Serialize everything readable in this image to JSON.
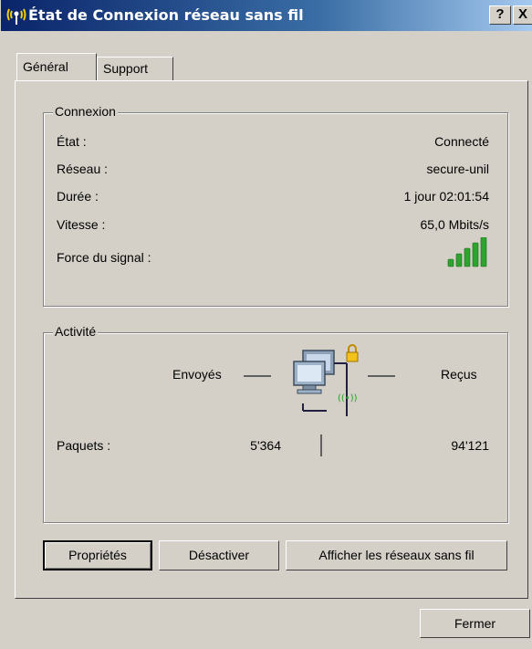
{
  "window": {
    "title": "État de Connexion réseau sans fil",
    "help_button": "?",
    "close_button": "X"
  },
  "tabs": [
    {
      "label": "Général",
      "active": true
    },
    {
      "label": "Support",
      "active": false
    }
  ],
  "connection": {
    "legend": "Connexion",
    "rows": [
      {
        "label": "État :",
        "value": "Connecté"
      },
      {
        "label": "Réseau :",
        "value": "secure-unil"
      },
      {
        "label": "Durée :",
        "value": "1 jour 02:01:54"
      },
      {
        "label": "Vitesse :",
        "value": "65,0 Mbits/s"
      }
    ],
    "signal_label": "Force du signal :",
    "signal_bars_lit": 5,
    "signal_bars_total": 5,
    "signal_color": "#2fa32f"
  },
  "activity": {
    "legend": "Activité",
    "sent_label": "Envoyés",
    "received_label": "Reçus",
    "packets_label": "Paquets :",
    "packets_sent": "5'364",
    "packets_received": "94'121",
    "icon": "network-computers-icon"
  },
  "buttons": {
    "properties": "Propriétés",
    "disable": "Désactiver",
    "show_networks": "Afficher les réseaux sans fil",
    "close": "Fermer"
  }
}
